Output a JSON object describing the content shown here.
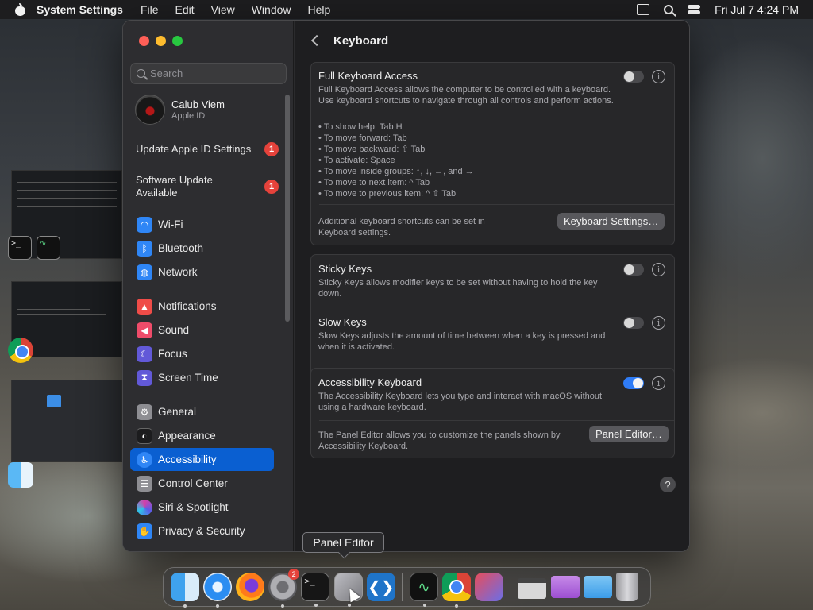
{
  "menubar": {
    "app_name": "System Settings",
    "items": [
      "File",
      "Edit",
      "View",
      "Window",
      "Help"
    ],
    "clock": "Fri Jul 7  4:24 PM"
  },
  "sidebar": {
    "search_placeholder": "Search",
    "profile": {
      "name": "Calub Viem",
      "sub": "Apple ID"
    },
    "alerts": [
      {
        "label": "Update Apple ID Settings",
        "badge": "1"
      },
      {
        "label": "Software Update Available",
        "badge": "1"
      }
    ],
    "items": [
      {
        "label": "Wi-Fi",
        "icon": "wifi-icon",
        "color": "#2f86f6"
      },
      {
        "label": "Bluetooth",
        "icon": "bluetooth-icon",
        "color": "#2f86f6"
      },
      {
        "label": "Network",
        "icon": "globe-icon",
        "color": "#2f86f6"
      },
      {
        "label": "Notifications",
        "icon": "bell-icon",
        "color": "#ef4c48"
      },
      {
        "label": "Sound",
        "icon": "speaker-icon",
        "color": "#ef4c6a"
      },
      {
        "label": "Focus",
        "icon": "moon-icon",
        "color": "#6259d8"
      },
      {
        "label": "Screen Time",
        "icon": "hourglass-icon",
        "color": "#6259d8"
      },
      {
        "label": "General",
        "icon": "gear-icon",
        "color": "#8e8e93"
      },
      {
        "label": "Appearance",
        "icon": "appearance-icon",
        "color": "#1c1c1e"
      },
      {
        "label": "Accessibility",
        "icon": "accessibility-icon",
        "color": "#2f86f6"
      },
      {
        "label": "Control Center",
        "icon": "control-center-icon",
        "color": "#8e8e93"
      },
      {
        "label": "Siri & Spotlight",
        "icon": "siri-icon",
        "color": "#d63fa8"
      },
      {
        "label": "Privacy & Security",
        "icon": "hand-icon",
        "color": "#2f86f6"
      }
    ],
    "active": "Accessibility"
  },
  "main": {
    "title": "Keyboard",
    "full_keyboard": {
      "title": "Full Keyboard Access",
      "description": "Full Keyboard Access allows the computer to be controlled with a keyboard. Use keyboard shortcuts to navigate through all controls and perform actions.",
      "shortcuts": [
        "• To show help: Tab H",
        "• To move forward: Tab",
        "• To move backward: ⇧ Tab",
        "• To activate: Space",
        "• To move inside groups: ↑, ↓, ←, and →",
        "• To move to next item: ^ Tab",
        "• To move to previous item: ^ ⇧ Tab"
      ],
      "footer": "Additional keyboard shortcuts can be set in Keyboard settings.",
      "button": "Keyboard Settings…",
      "enabled": false
    },
    "sticky_keys": {
      "title": "Sticky Keys",
      "description": "Sticky Keys allows modifier keys to be set without having to hold the key down.",
      "enabled": false
    },
    "slow_keys": {
      "title": "Slow Keys",
      "description": "Slow Keys adjusts the amount of time between when a key is pressed and when it is activated.",
      "enabled": false
    },
    "accessibility_keyboard": {
      "title": "Accessibility Keyboard",
      "description": "The Accessibility Keyboard lets you type and interact with macOS without using a hardware keyboard.",
      "footer": "The Panel Editor allows you to customize the panels shown by Accessibility Keyboard.",
      "button": "Panel Editor…",
      "enabled": true
    },
    "help": "?"
  },
  "tooltip": "Panel Editor",
  "dock": {
    "apps": [
      "Finder",
      "Safari",
      "Firefox",
      "System Settings",
      "Terminal",
      "Accessibility Keyboard",
      "Visual Studio Code",
      "Activity Monitor",
      "Google Chrome",
      "Lasso",
      "Files",
      "Folder",
      "Folder",
      "Trash"
    ],
    "settings_badge": "2"
  }
}
